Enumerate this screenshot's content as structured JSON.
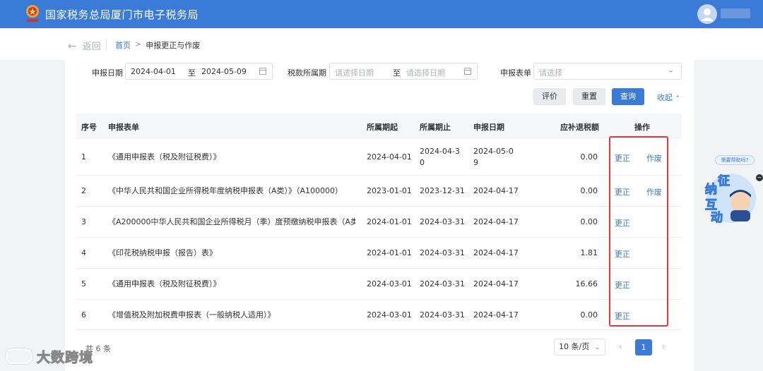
{
  "header": {
    "title": "国家税务总局厦门市电子税务局"
  },
  "nav": {
    "back": "返回",
    "breadcrumb_home": "首页",
    "breadcrumb_sep": ">",
    "breadcrumb_current": "申报更正与作废"
  },
  "filters": {
    "declare_date_label": "申报日期",
    "declare_date_start": "2024-04-01",
    "declare_date_to": "至",
    "declare_date_end": "2024-05-09",
    "tax_period_label": "税款所属期",
    "tax_period_start_ph": "请选择日期",
    "tax_period_to": "至",
    "tax_period_end_ph": "请选择日期",
    "form_label": "申报表单",
    "form_ph": "请选择"
  },
  "actions": {
    "evaluate": "评价",
    "reset": "重置",
    "query": "查询",
    "collapse": "收起"
  },
  "table": {
    "headers": {
      "seq": "序号",
      "form": "申报表单",
      "start": "所属期起",
      "end": "所属期止",
      "date": "申报日期",
      "amount": "应补退税额",
      "ops": "操作"
    },
    "rows": [
      {
        "seq": "1",
        "form": "《通用申报表（税及附征税费）》",
        "start": "2024-04-01",
        "end": "2024-04-30",
        "date": "2024-05-09",
        "amount": "0.00",
        "correct": "更正",
        "void": "作废"
      },
      {
        "seq": "2",
        "form": "《中华人民共和国企业所得税年度纳税申报表（A类）》（A100000）",
        "start": "2023-01-01",
        "end": "2023-12-31",
        "date": "2024-04-17",
        "amount": "0.00",
        "correct": "更正",
        "void": "作废"
      },
      {
        "seq": "3",
        "form": "《A200000中华人民共和国企业所得税月（季）度预缴纳税申报表（A类...",
        "start": "2024-01-01",
        "end": "2024-03-31",
        "date": "2024-04-17",
        "amount": "0.00",
        "correct": "更正",
        "void": ""
      },
      {
        "seq": "4",
        "form": "《印花税纳税申报（报告）表》",
        "start": "2024-01-01",
        "end": "2024-03-31",
        "date": "2024-04-17",
        "amount": "1.81",
        "correct": "更正",
        "void": ""
      },
      {
        "seq": "5",
        "form": "《通用申报表（税及附征税费）》",
        "start": "2024-03-01",
        "end": "2024-03-31",
        "date": "2024-04-17",
        "amount": "16.66",
        "correct": "更正",
        "void": ""
      },
      {
        "seq": "6",
        "form": "《增值税及附加税费申报表（一般纳税人适用）》",
        "start": "2024-03-01",
        "end": "2024-03-31",
        "date": "2024-04-17",
        "amount": "0.00",
        "correct": "更正",
        "void": ""
      }
    ]
  },
  "pagination": {
    "total": "共 6 条",
    "page_size": "10 条/页",
    "current": "1",
    "prev": "‹",
    "next": "›"
  },
  "helper": {
    "bubble": "需要帮助吗?",
    "c1": "征",
    "c2": "纳",
    "c3": "互",
    "c4": "动",
    "close": "−"
  },
  "watermark": {
    "text": "大数跨境"
  },
  "colors": {
    "primary": "#3b7bd8",
    "highlight_box": "#e03a3a"
  }
}
